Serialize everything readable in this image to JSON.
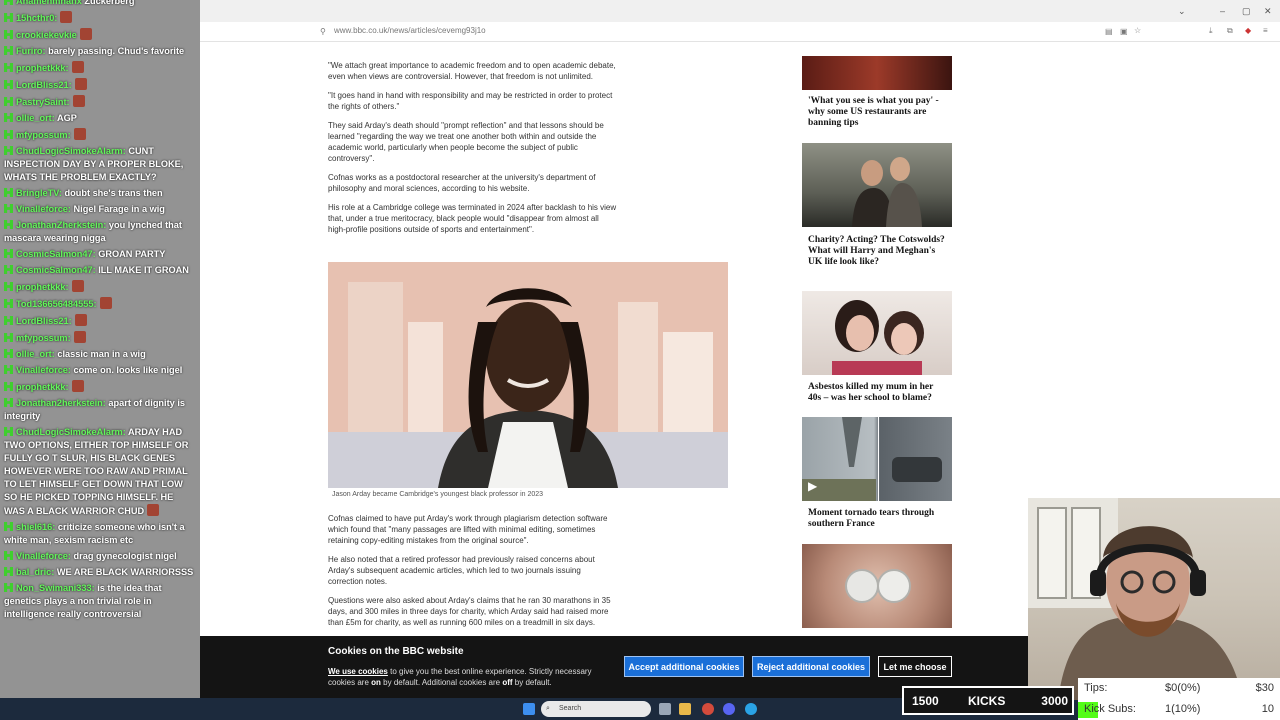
{
  "browser": {
    "url": "www.bbc.co.uk/news/articles/cevemg93j1o",
    "window_controls": [
      "–",
      "▢",
      "✕"
    ]
  },
  "article": {
    "paragraphs_top": [
      "\"We attach great importance to academic freedom and to open academic debate, even when views are controversial. However, that freedom is not unlimited.",
      "\"It goes hand in hand with responsibility and may be restricted in order to protect the rights of others.\"",
      "They said Arday's death should \"prompt reflection\" and that lessons should be learned \"regarding the way we treat one another both within and outside the academic world, particularly when people become the subject of public controversy\".",
      "Cofnas works as a postdoctoral researcher at the university's department of philosophy and moral sciences, according to his website.",
      "His role at a Cambridge college was terminated in 2024 after backlash to his view that, under a true meritocracy, black people would \"disappear from almost all high-profile positions outside of sports and entertainment\"."
    ],
    "caption": "Jason Arday became Cambridge's youngest black professor in 2023",
    "paragraphs_bottom": [
      "Cofnas claimed to have put Arday's work through plagiarism detection software which found that \"many passages are lifted with minimal editing, sometimes retaining copy-editing mistakes from the original source\".",
      "He also noted that a retired professor had previously raised concerns about Arday's subsequent academic articles, which led to two journals issuing correction notes.",
      "Questions were also asked about Arday's claims that he ran 30 marathons in 35 days, and 300 miles in three days for charity, which Arday said had raised more than £5m for charity, as well as running 600 miles on a treadmill in six days."
    ]
  },
  "sidebar": {
    "promos": [
      {
        "title": "'What you see is what you pay' - why some US restaurants are banning tips"
      },
      {
        "title": "Charity? Acting? The Cotswolds? What will Harry and Meghan's UK life look like?"
      },
      {
        "title": "Asbestos killed my mum in her 40s – was her school to blame?"
      },
      {
        "title": "Moment tornado tears through southern France"
      }
    ]
  },
  "chat": {
    "messages": [
      {
        "user": "Ahamenmhanx",
        "text": " Zuckerberg",
        "emote": false
      },
      {
        "user": "15hcthr0:",
        "text": "",
        "emote": true
      },
      {
        "user": "crookiekevkie",
        "text": "",
        "emote": true
      },
      {
        "user": "Furiro:",
        "text": " barely passing. Chud's favorite",
        "emote": false
      },
      {
        "user": "prophetkkk:",
        "text": "",
        "emote": true
      },
      {
        "user": "LordBliss21:",
        "text": "",
        "emote": true
      },
      {
        "user": "PastrySaint:",
        "text": "",
        "emote": true
      },
      {
        "user": "ollie_ort:",
        "text": " AGP",
        "emote": false
      },
      {
        "user": "mfypossum:",
        "text": "",
        "emote": true
      },
      {
        "user": "ChudLogicSimokeAlarm:",
        "text": " CUNT INSPECTION DAY BY A PROPER BLOKE, WHATS THE PROBLEM EXACTLY?",
        "emote": false
      },
      {
        "user": "BringleTV:",
        "text": " doubt she's trans then",
        "emote": false
      },
      {
        "user": "Vinalleforce:",
        "text": " Nigel Farage in a wig",
        "emote": false
      },
      {
        "user": "JonathanZherkstein:",
        "text": " you lynched that mascara wearing nigga",
        "emote": false
      },
      {
        "user": "CosmicSalmon47:",
        "text": " GROAN PARTY",
        "emote": false
      },
      {
        "user": "CosmicSalmon47:",
        "text": " ILL MAKE IT GROAN",
        "emote": false
      },
      {
        "user": "prophetkkk:",
        "text": "",
        "emote": true
      },
      {
        "user": "Tod136656484555:",
        "text": "",
        "emote": true
      },
      {
        "user": "LordBliss21:",
        "text": "",
        "emote": true
      },
      {
        "user": "mfypossum:",
        "text": "",
        "emote": true
      },
      {
        "user": "ollie_ort:",
        "text": " classic man in a wig",
        "emote": false
      },
      {
        "user": "Vinalleforce:",
        "text": " come on. looks like nigel",
        "emote": false
      },
      {
        "user": "prophetkkk:",
        "text": "",
        "emote": true
      },
      {
        "user": "Jonathan2herkstein:",
        "text": " apart of dignity is integrity",
        "emote": false
      },
      {
        "user": "ChudLogicSimokeAlarm:",
        "text": " ARDAY HAD TWO OPTIONS, EITHER TOP HIMSELF OR FULLY GO T SLUR, HIS BLACK GENES HOWEVER WERE TOO RAW AND PRIMAL TO LET HIMSELF GET DOWN THAT LOW SO HE PICKED TOPPING HIMSELF. HE WAS A BLACK WARRIOR CHUD",
        "emote": true
      },
      {
        "user": "shiel616:",
        "text": " criticize someone who isn't a white man, sexism racism etc",
        "emote": false
      },
      {
        "user": "Vinalleforce:",
        "text": " drag gynecologist nigel",
        "emote": false
      },
      {
        "user": "bal_dric:",
        "text": " WE ARE BLACK WARRIORSSS",
        "emote": false
      },
      {
        "user": "Non_Swimani333:",
        "text": " is the idea that genetics plays a non trivial role in intelligence really controversial",
        "emote": false
      }
    ]
  },
  "cookie_banner": {
    "title": "Cookies on the BBC website",
    "text_link": "We use cookies",
    "text_part1": " to give you the best online experience. Strictly necessary cookies are ",
    "text_on": "on",
    "text_part2": " by default. Additional cookies are ",
    "text_off": "off",
    "text_part3": " by default.",
    "accept_label": "Accept additional cookies",
    "reject_label": "Reject additional cookies",
    "choose_label": "Let me choose"
  },
  "taskbar": {
    "search_placeholder": "Search"
  },
  "kicks_widget": {
    "start": "1500",
    "label": "KICKS",
    "goal": "3000"
  },
  "stats_widget": {
    "tips_label": "Tips:",
    "tips_value": "$0(0%)",
    "tips_goal": "$30",
    "subs_label": "Kick Subs:",
    "subs_value": "1(10%)",
    "subs_goal": "10",
    "subs_progress": 0.1
  }
}
